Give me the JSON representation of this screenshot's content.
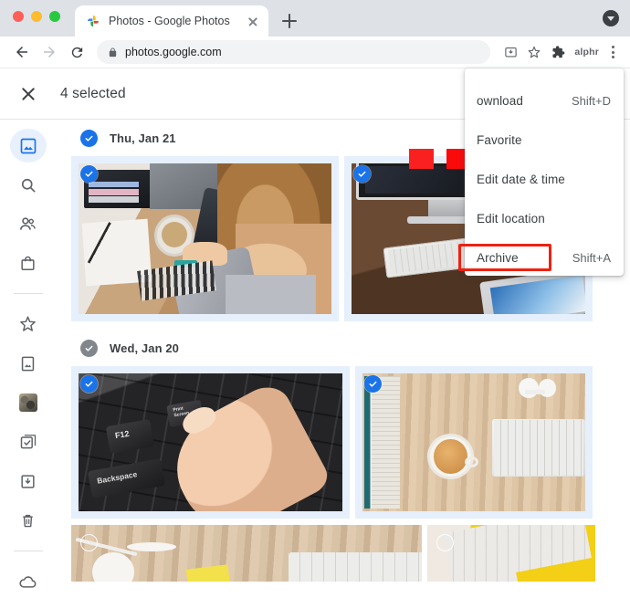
{
  "browser": {
    "tab": {
      "title": "Photos - Google Photos",
      "favicon": "google-photos-pinwheel-icon"
    },
    "new_tab_label": "+",
    "address": "photos.google.com",
    "profile_label": "alphr",
    "icons": [
      "back-arrow-icon",
      "forward-arrow-icon",
      "reload-icon",
      "lock-icon",
      "install-icon",
      "bookmark-star-icon",
      "extensions-puzzle-icon",
      "chrome-menu-kebab-icon"
    ]
  },
  "header": {
    "close_label": "close-selection",
    "title": "4 selected",
    "redaction_color": "#fa2020"
  },
  "sidebar": {
    "items": [
      {
        "name": "photos",
        "icon": "photos-icon",
        "active": true
      },
      {
        "name": "search",
        "icon": "search-icon",
        "active": false
      },
      {
        "name": "sharing",
        "icon": "people-sharing-icon",
        "active": false
      },
      {
        "name": "store",
        "icon": "shopping-bag-icon",
        "active": false
      },
      {
        "name": "favorites",
        "icon": "star-icon",
        "active": false
      },
      {
        "name": "albums",
        "icon": "album-bookmark-icon",
        "active": false
      },
      {
        "name": "memories",
        "icon": "photo-thumbnail-icon",
        "active": false
      },
      {
        "name": "utilities",
        "icon": "checkbox-stack-icon",
        "active": false
      },
      {
        "name": "archive",
        "icon": "archive-box-icon",
        "active": false
      },
      {
        "name": "trash",
        "icon": "trash-can-icon",
        "active": false
      },
      {
        "name": "storage",
        "icon": "cloud-icon",
        "active": false
      }
    ]
  },
  "content": {
    "groups": [
      {
        "date_label": "Thu, Jan 21",
        "check_state": "selected",
        "photos": [
          {
            "alt": "person-holding-smartphone-at-desk",
            "selected": true
          },
          {
            "alt": "imac-desktop-keyboard-tablet",
            "selected": true
          }
        ]
      },
      {
        "date_label": "Wed, Jan 20",
        "check_state": "partial",
        "photos": [
          {
            "alt": "finger-pressing-print-screen-key",
            "selected": true
          },
          {
            "alt": "notebook-coffee-keyboard-earbuds-flatlay",
            "selected": true
          }
        ]
      },
      {
        "date_label": "",
        "check_state": "none",
        "photos": [
          {
            "alt": "earbuds-keyboard-on-wood-desk",
            "selected": false
          },
          {
            "alt": "keyboard-on-yellow-background",
            "selected": false
          }
        ]
      }
    ]
  },
  "menu": {
    "items": [
      {
        "label": "ownload",
        "shortcut": "Shift+D",
        "highlighted": false
      },
      {
        "label": "Favorite",
        "shortcut": "",
        "highlighted": false
      },
      {
        "label": "Edit date & time",
        "shortcut": "",
        "highlighted": false
      },
      {
        "label": "Edit location",
        "shortcut": "",
        "highlighted": false
      },
      {
        "label": "Archive",
        "shortcut": "Shift+A",
        "highlighted": true
      }
    ],
    "highlight_color": "#ee2211"
  },
  "colors": {
    "accent_blue": "#1a73e8",
    "selected_tile_bg": "#e6effc",
    "gray_check": "#80868b"
  }
}
